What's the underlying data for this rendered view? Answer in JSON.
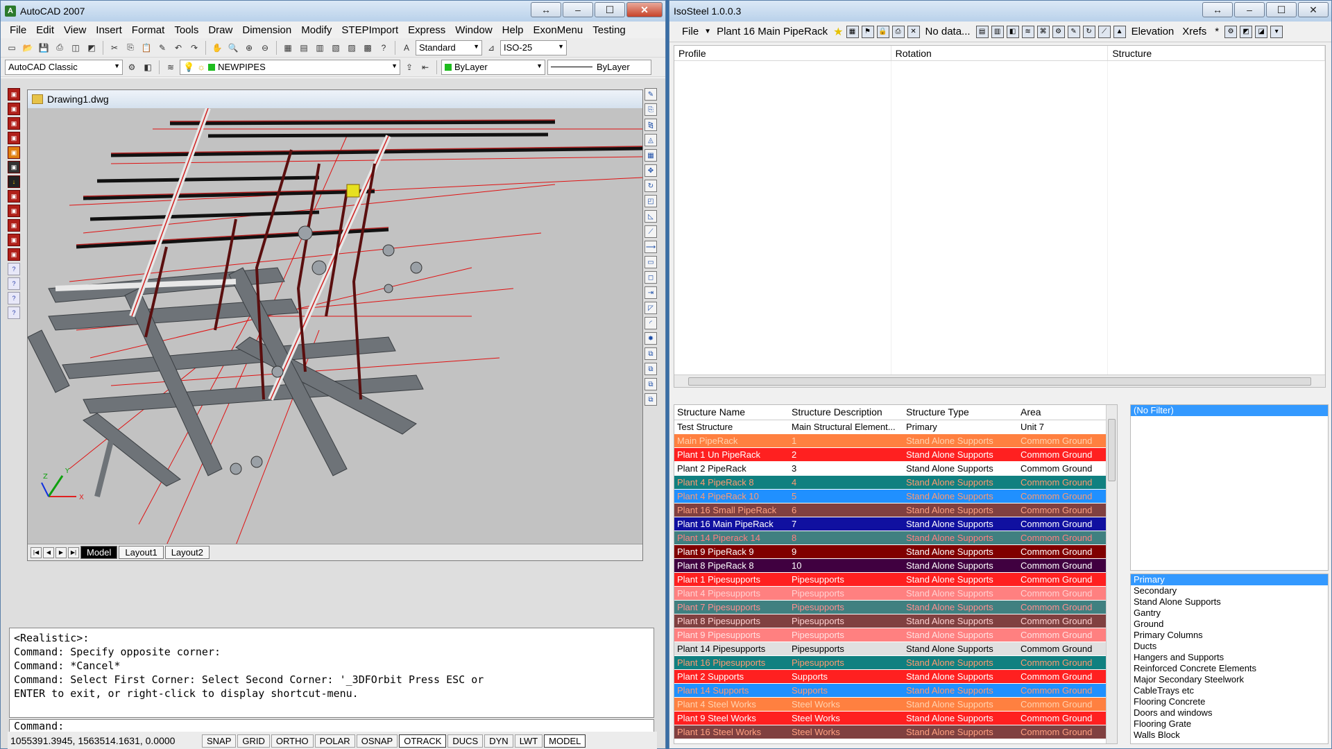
{
  "autocad": {
    "title": "AutoCAD 2007",
    "menu": [
      "File",
      "Edit",
      "View",
      "Insert",
      "Format",
      "Tools",
      "Draw",
      "Dimension",
      "Modify",
      "STEPImport",
      "Express",
      "Window",
      "Help",
      "ExonMenu",
      "Testing"
    ],
    "toolbar1": {
      "text_style": "Standard",
      "dim_style": "ISO-25"
    },
    "toolbar2": {
      "workspace": "AutoCAD Classic",
      "layer": "NEWPIPES",
      "color": "ByLayer",
      "linetype": "ByLayer"
    },
    "drawing_title": "Drawing1.dwg",
    "layout_tabs": [
      "Model",
      "Layout1",
      "Layout2"
    ],
    "command_history": [
      "<Realistic>:",
      "Command: Specify opposite corner:",
      "Command: *Cancel*",
      "Command: Select First Corner: Select Second Corner: '_3DFOrbit Press ESC or",
      "ENTER to exit, or right-click to display shortcut-menu."
    ],
    "command_prompt": "Command:",
    "coords": "1055391.3945, 1563514.1631, 0.0000",
    "status_buttons": [
      "SNAP",
      "GRID",
      "ORTHO",
      "POLAR",
      "OSNAP",
      "OTRACK",
      "DUCS",
      "DYN",
      "LWT",
      "MODEL"
    ]
  },
  "isosteel": {
    "title": "IsoSteel 1.0.0.3",
    "toolbar": {
      "file": "File",
      "structure": "Plant 16 Main PipeRack",
      "no_data": "No data...",
      "elevation": "Elevation",
      "xrefs": "Xrefs",
      "star": "*"
    },
    "profile_headers": [
      "Profile",
      "Rotation",
      "Structure"
    ],
    "struct_headers": [
      "Structure Name",
      "Structure Description",
      "Structure Type",
      "Area"
    ],
    "rows": [
      {
        "name": "Test Structure",
        "desc": "Main Structural Element...",
        "type": "Primary",
        "area": "Unit 7",
        "bg": "#ffffff",
        "fg": "#000000"
      },
      {
        "name": "Main PipeRack",
        "desc": "1",
        "type": "Stand Alone Supports",
        "area": "Commom Ground",
        "bg": "#ff8040",
        "fg": "#ffd2b0"
      },
      {
        "name": "Plant 1 Un PipeRack",
        "desc": "2",
        "type": "Stand Alone Supports",
        "area": "Commom Ground",
        "bg": "#ff2020",
        "fg": "#ffffff"
      },
      {
        "name": "Plant 2 PipeRack",
        "desc": "3",
        "type": "Stand Alone Supports",
        "area": "Commom Ground",
        "bg": "#ffffff",
        "fg": "#000000"
      },
      {
        "name": "Plant 4 PipeRack 8",
        "desc": "4",
        "type": "Stand Alone Supports",
        "area": "Commom Ground",
        "bg": "#108080",
        "fg": "#ff9a70"
      },
      {
        "name": "Plant 4 PipeRack 10",
        "desc": "5",
        "type": "Stand Alone Supports",
        "area": "Commom Ground",
        "bg": "#2090ff",
        "fg": "#ff9a70"
      },
      {
        "name": "Plant 16 Small PipeRack",
        "desc": "6",
        "type": "Stand Alone Supports",
        "area": "Commom Ground",
        "bg": "#804040",
        "fg": "#ffa080"
      },
      {
        "name": "Plant 16 Main PipeRack",
        "desc": "7",
        "type": "Stand Alone Supports",
        "area": "Commom Ground",
        "bg": "#1010a0",
        "fg": "#ffffff"
      },
      {
        "name": "Plant 14 Piperack 14",
        "desc": "8",
        "type": "Stand Alone Supports",
        "area": "Commom Ground",
        "bg": "#408080",
        "fg": "#ff8080"
      },
      {
        "name": "Plant 9 PipeRack 9",
        "desc": "9",
        "type": "Stand Alone Supports",
        "area": "Commom Ground",
        "bg": "#800000",
        "fg": "#ffffff"
      },
      {
        "name": "Plant 8 PipeRack 8",
        "desc": "10",
        "type": "Stand Alone Supports",
        "area": "Commom Ground",
        "bg": "#400040",
        "fg": "#ffffff"
      },
      {
        "name": "Plant 1 Pipesupports",
        "desc": "Pipesupports",
        "type": "Stand Alone Supports",
        "area": "Commom Ground",
        "bg": "#ff2020",
        "fg": "#ffffff"
      },
      {
        "name": "Plant 4 Pipesupports",
        "desc": "Pipesupports",
        "type": "Stand Alone Supports",
        "area": "Commom Ground",
        "bg": "#ff8080",
        "fg": "#ffd0d0"
      },
      {
        "name": "Plant 7 Pipesupports",
        "desc": "Pipesupports",
        "type": "Stand Alone Supports",
        "area": "Commom Ground",
        "bg": "#408080",
        "fg": "#ff9090"
      },
      {
        "name": "Plant 8 Pipesupports",
        "desc": "Pipesupports",
        "type": "Stand Alone Supports",
        "area": "Commom Ground",
        "bg": "#804040",
        "fg": "#ffd0d0"
      },
      {
        "name": "Plant 9 Pipesupports",
        "desc": "Pipesupports",
        "type": "Stand Alone Supports",
        "area": "Commom Ground",
        "bg": "#ff8080",
        "fg": "#ffe0e0"
      },
      {
        "name": "Plant 14 Pipesupports",
        "desc": "Pipesupports",
        "type": "Stand Alone Supports",
        "area": "Commom Ground",
        "bg": "#e0e0e0",
        "fg": "#000000"
      },
      {
        "name": "Plant 16 Pipesupports",
        "desc": "Pipesupports",
        "type": "Stand Alone Supports",
        "area": "Commom Ground",
        "bg": "#108080",
        "fg": "#ff9a70"
      },
      {
        "name": "Plant 2 Supports",
        "desc": "Supports",
        "type": "Stand Alone Supports",
        "area": "Commom Ground",
        "bg": "#ff2020",
        "fg": "#ffffff"
      },
      {
        "name": "Plant 14 Supports",
        "desc": "Supports",
        "type": "Stand Alone Supports",
        "area": "Commom Ground",
        "bg": "#2090ff",
        "fg": "#ff9a70"
      },
      {
        "name": "Plant 4 Steel Works",
        "desc": "Steel Works",
        "type": "Stand Alone Supports",
        "area": "Commom Ground",
        "bg": "#ff8040",
        "fg": "#ffd2b0"
      },
      {
        "name": "Plant 9 Steel Works",
        "desc": "Steel Works",
        "type": "Stand Alone Supports",
        "area": "Commom Ground",
        "bg": "#ff2020",
        "fg": "#ffffff"
      },
      {
        "name": "Plant 16 Steel Works",
        "desc": "Steel Works",
        "type": "Stand Alone Supports",
        "area": "Commom Ground",
        "bg": "#804040",
        "fg": "#ffa080"
      }
    ],
    "filter_list": [
      "(No Filter)"
    ],
    "type_list": [
      "Primary",
      "Secondary",
      "Stand Alone Supports",
      "Gantry",
      "Ground",
      "Primary Columns",
      "Ducts",
      "Hangers and Supports",
      "Reinforced Concrete Elements",
      "Major Secondary Steelwork",
      "CableTrays etc",
      "Flooring Concrete",
      "Doors and windows",
      "Flooring Grate",
      "Walls Block"
    ]
  }
}
